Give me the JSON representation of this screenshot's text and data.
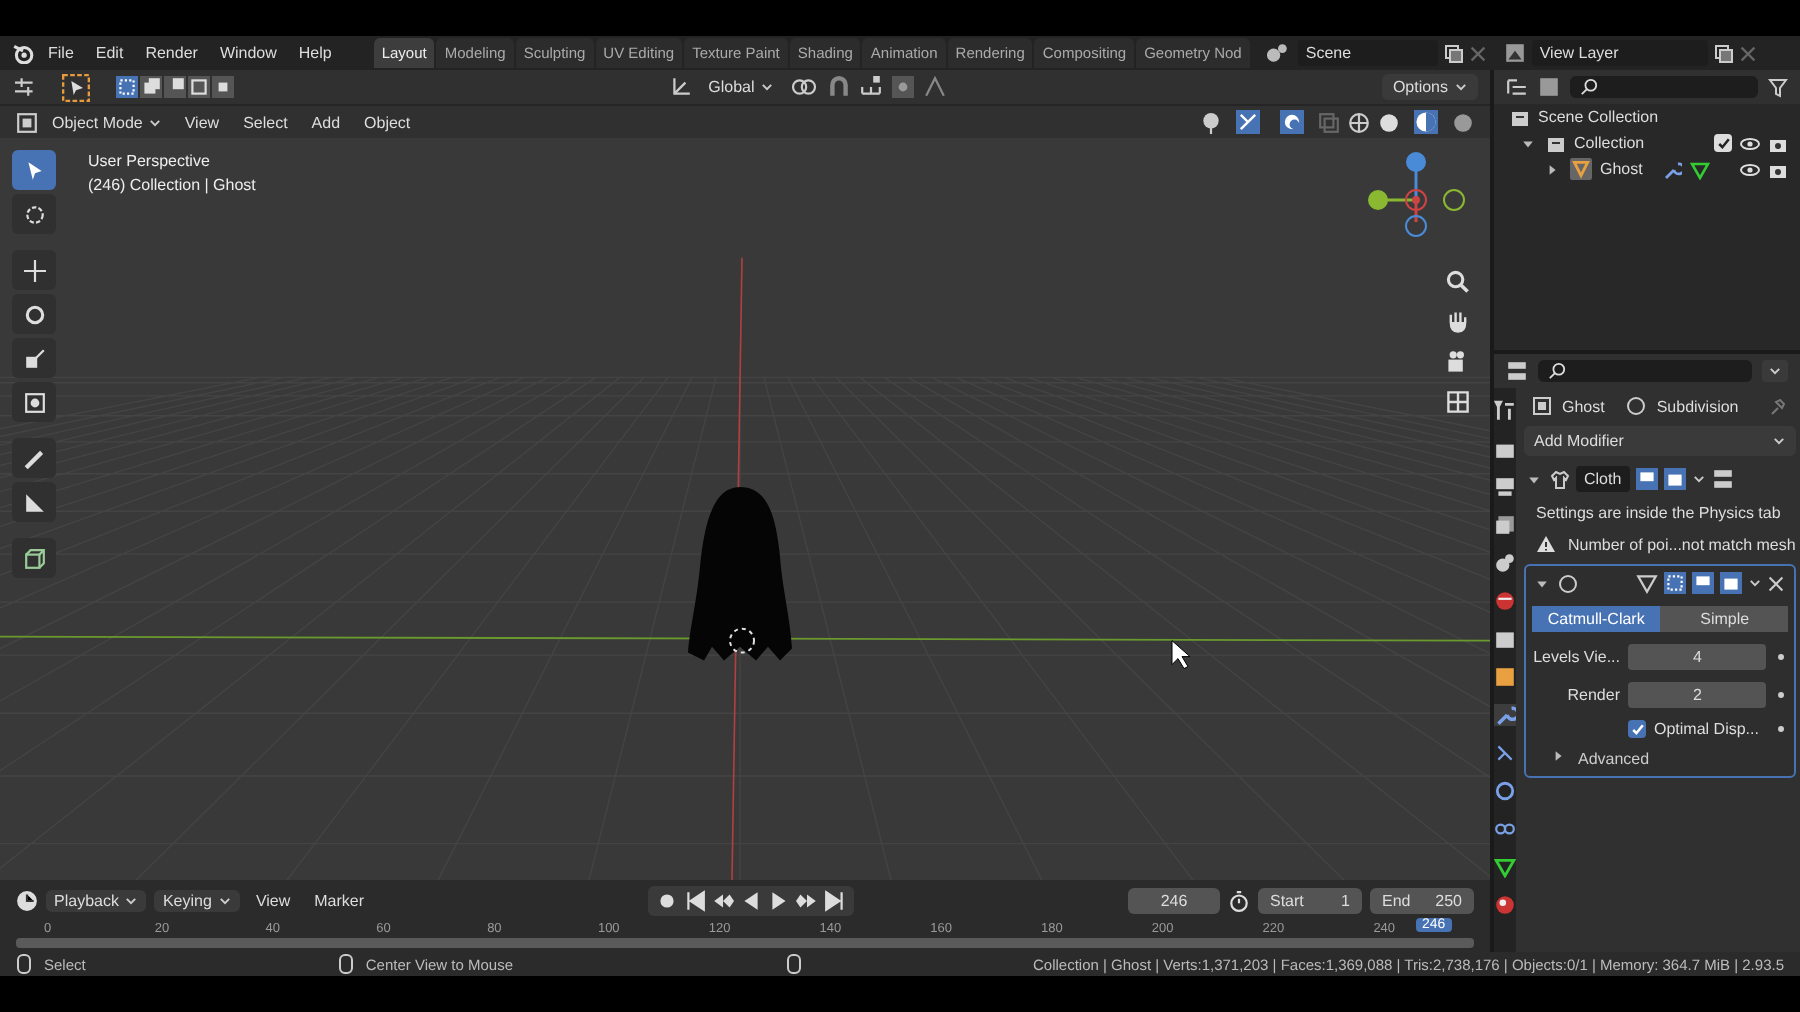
{
  "topbar": {
    "menus": [
      "File",
      "Edit",
      "Render",
      "Window",
      "Help"
    ],
    "workspaces": [
      {
        "label": "Layout",
        "selected": true
      },
      {
        "label": "Modeling",
        "selected": false
      },
      {
        "label": "Sculpting",
        "selected": false
      },
      {
        "label": "UV Editing",
        "selected": false
      },
      {
        "label": "Texture Paint",
        "selected": false
      },
      {
        "label": "Shading",
        "selected": false
      },
      {
        "label": "Animation",
        "selected": false
      },
      {
        "label": "Rendering",
        "selected": false
      },
      {
        "label": "Compositing",
        "selected": false
      },
      {
        "label": "Geometry Nod",
        "selected": false
      }
    ],
    "scene": "Scene",
    "view_layer": "View Layer"
  },
  "tool_header": {
    "orientation": "Global",
    "options": "Options"
  },
  "viewport": {
    "mode": "Object Mode",
    "menus": [
      "View",
      "Select",
      "Add",
      "Object"
    ],
    "view_name": "User Perspective",
    "view_info": "(246) Collection | Ghost"
  },
  "outliner": {
    "items": [
      {
        "label": "Scene Collection",
        "children": [
          {
            "label": "Collection",
            "expanded": true,
            "checked": true,
            "children": [
              {
                "label": "Ghost",
                "expanded": false
              }
            ]
          }
        ]
      }
    ]
  },
  "properties": {
    "object": "Ghost",
    "modifier": "Subdivision",
    "add_modifier": "Add Modifier",
    "modifiers": [
      {
        "kind": "cloth",
        "name": "Cloth",
        "expanded": true,
        "info": "Settings are inside the Physics tab",
        "warning": "Number of poi...not match mesh"
      },
      {
        "kind": "subdivision",
        "expanded": true,
        "methods": [
          {
            "label": "Catmull-Clark",
            "selected": true
          },
          {
            "label": "Simple",
            "selected": false
          }
        ],
        "fields": [
          {
            "label": "Levels Vie...",
            "value": "4"
          },
          {
            "label": "Render",
            "value": "2"
          }
        ],
        "option": {
          "label": "Optimal Disp...",
          "checked": true
        },
        "advanced": {
          "label": "Advanced",
          "expanded": false
        }
      }
    ]
  },
  "timeline": {
    "menus": [
      "Playback",
      "Keying",
      "View",
      "Marker"
    ],
    "current_frame": "246",
    "start_label": "Start",
    "start": "1",
    "end_label": "End",
    "end": "250",
    "ticks": [
      "0",
      "20",
      "40",
      "60",
      "80",
      "100",
      "120",
      "140",
      "160",
      "180",
      "200",
      "220",
      "240"
    ],
    "playhead": "246"
  },
  "status_bar": {
    "left": "Select",
    "middle": "Center View to Mouse",
    "stats": "Collection | Ghost | Verts:1,371,203 | Faces:1,369,088 | Tris:2,738,176 | Objects:0/1 | Memory: 364.7 MiB | 2.93.5"
  }
}
